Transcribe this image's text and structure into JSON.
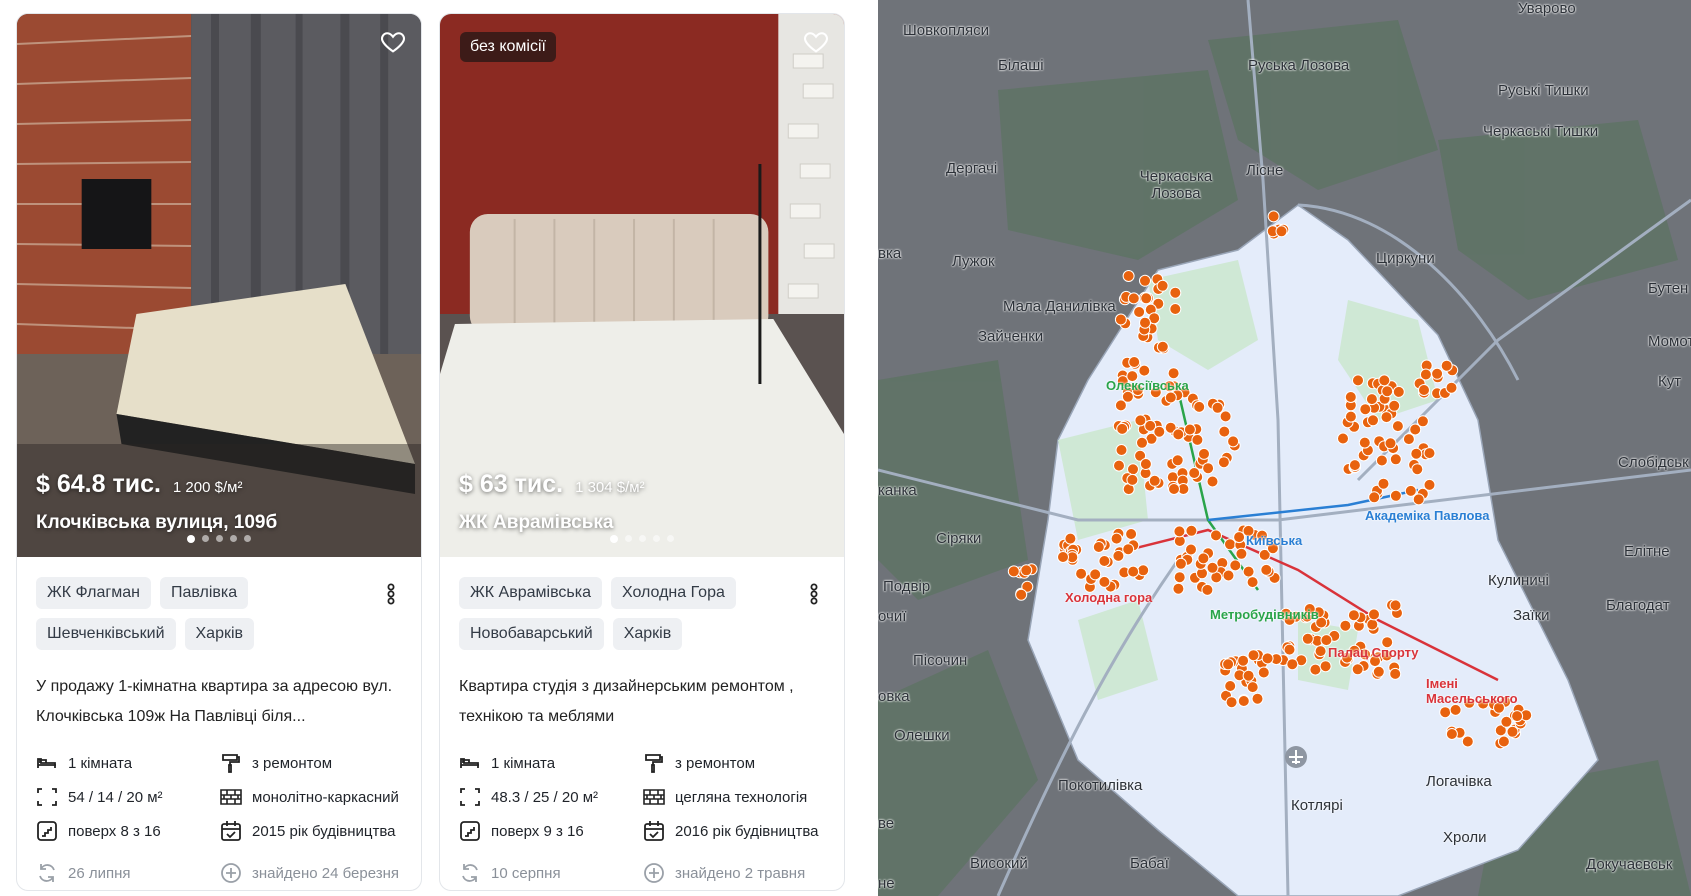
{
  "listings": [
    {
      "badge": "",
      "price": "$ 64.8 тис.",
      "price_per_m2": "1 200 $/м²",
      "address": "Клочківська вулиця, 109б",
      "tags": [
        "ЖК Флагман",
        "Павлівка",
        "Шевченківський",
        "Харків"
      ],
      "description": "У продажу 1-кімнатна квартира за адресою вул. Клочківська 109ж На Павлівці біля...",
      "rooms": "1 кімната",
      "area": "54 / 14 / 20 м²",
      "floor": "поверх 8 з 16",
      "renovation": "з ремонтом",
      "material": "монолітно-каркасний",
      "year": "2015 рік будівництва",
      "updated": "26 липня",
      "found": "знайдено 24 березня"
    },
    {
      "badge": "без комісії",
      "price": "$ 63 тис.",
      "price_per_m2": "1 304 $/м²",
      "address": "ЖК Аврамівська",
      "tags": [
        "ЖК Аврамівська",
        "Холодна Гора",
        "Новобаварський",
        "Харків"
      ],
      "description": "Квартира студія з дизайнерським ремонтом , технікою та меблями",
      "rooms": "1 кімната",
      "area": "48.3 / 25 / 20 м²",
      "floor": "поверх 9 з 16",
      "renovation": "з ремонтом",
      "material": "цегляна технологія",
      "year": "2016 рік будівництва",
      "updated": "10 серпня",
      "found": "знайдено 2 травня"
    }
  ],
  "map": {
    "places": [
      "Шовкопляси",
      "Білаші",
      "Руська Лозова",
      "Руські Тишки",
      "Черкаські Тишки",
      "Дергачі",
      "Черкаська Лозова",
      "Лісне",
      "Лужок",
      "Циркуни",
      "Бутен",
      "Мала Данилівка",
      "Зайченки",
      "Момот",
      "Кут",
      "Слобідськ",
      "Сіряки",
      "Подвір",
      "Кулиничі",
      "Елітне",
      "Заїки",
      "Благодат",
      "Пісочин",
      "Олешки",
      "Покотилівка",
      "Котлярі",
      "Логачівка",
      "Хроли",
      "Високий",
      "Бабаї",
      "Докучаєвськ",
      "Уварово",
      "канка",
      "вка",
      "очиї",
      "овка",
      "ве",
      "не"
    ],
    "metro": [
      "Олексіївська",
      "Київська",
      "Академіка Павлова",
      "Метробудівників",
      "Холодна гора",
      "Палац Спорту",
      "Імені Масельського"
    ],
    "colors": {
      "marker": "#e8620e",
      "marker_stroke": "#ffffff",
      "city": "#e4ecfa",
      "green": "#cfe8d5",
      "outside": "#6f7379"
    }
  }
}
